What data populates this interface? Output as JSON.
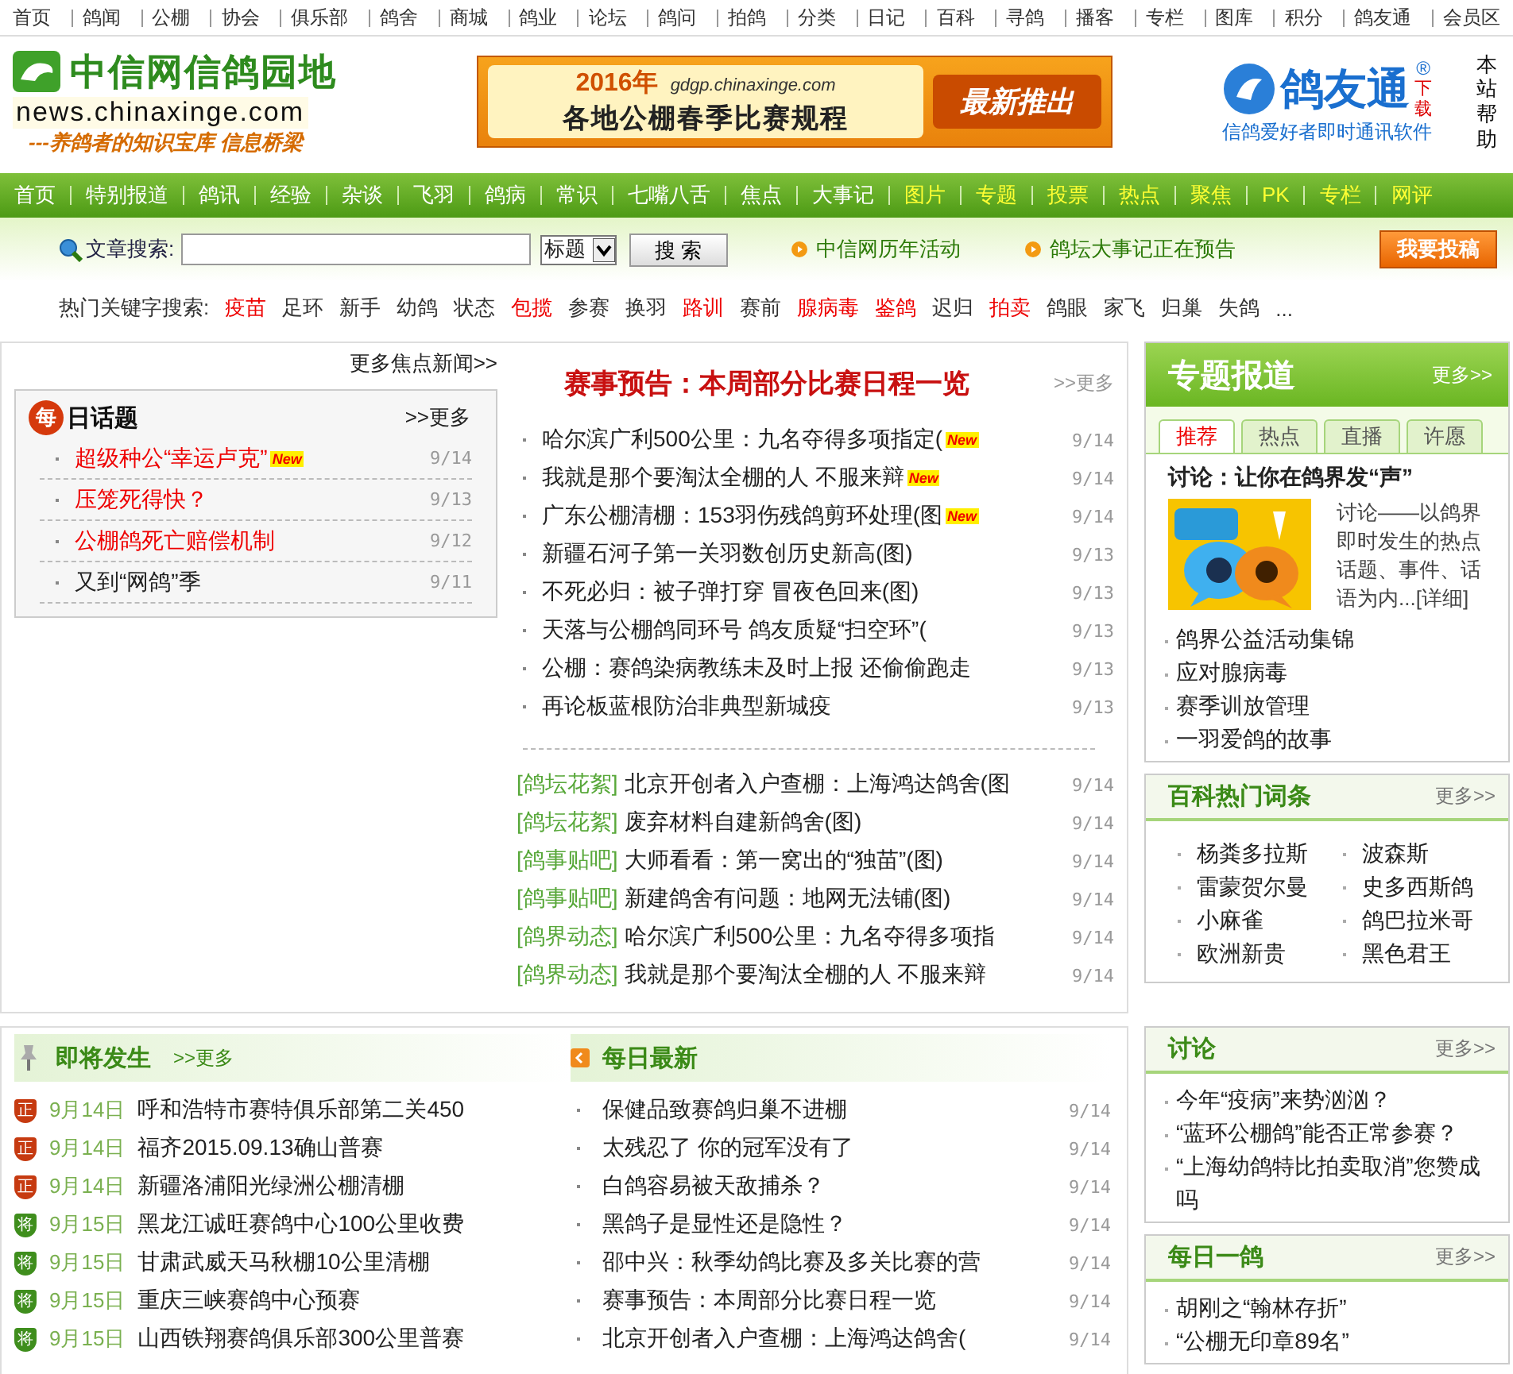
{
  "top_nav": [
    "首页",
    "鸽闻",
    "公棚",
    "协会",
    "俱乐部",
    "鸽舍",
    "商城",
    "鸽业",
    "论坛",
    "鸽问",
    "拍鸽",
    "分类",
    "日记",
    "百科",
    "寻鸽",
    "播客",
    "专栏",
    "图库",
    "积分",
    "鸽友通",
    "会员区"
  ],
  "header": {
    "logo_title": "中信网信鸽园地",
    "logo_url": "news.chinaxinge.com",
    "logo_slogan": "---养鸽者的知识宝库  信息桥梁",
    "banner": {
      "year": "2016年",
      "url": "gdgp.chinaxinge.com",
      "title": "各地公棚春季比赛规程",
      "tag": "最新推出"
    },
    "app": {
      "name": "鸽友通",
      "reg": "®",
      "download": "下载",
      "caption": "信鸽爱好者即时通讯软件"
    },
    "help": "本站帮助"
  },
  "main_nav": [
    {
      "label": "首页",
      "kind": "normal"
    },
    {
      "label": "特别报道",
      "kind": "normal"
    },
    {
      "label": "鸽讯",
      "kind": "normal"
    },
    {
      "label": "经验",
      "kind": "normal"
    },
    {
      "label": "杂谈",
      "kind": "normal"
    },
    {
      "label": "飞羽",
      "kind": "normal"
    },
    {
      "label": "鸽病",
      "kind": "normal"
    },
    {
      "label": "常识",
      "kind": "normal"
    },
    {
      "label": "七嘴八舌",
      "kind": "normal"
    },
    {
      "label": "焦点",
      "kind": "normal"
    },
    {
      "label": "大事记",
      "kind": "normal"
    },
    {
      "label": "图片",
      "kind": "featured"
    },
    {
      "label": "专题",
      "kind": "featured"
    },
    {
      "label": "投票",
      "kind": "featured"
    },
    {
      "label": "热点",
      "kind": "featured"
    },
    {
      "label": "聚焦",
      "kind": "featured"
    },
    {
      "label": "PK",
      "kind": "featured"
    },
    {
      "label": "专栏",
      "kind": "featured"
    },
    {
      "label": "网评",
      "kind": "featured"
    }
  ],
  "search": {
    "label": "文章搜索:",
    "select": "标题",
    "button": "搜 索",
    "links": [
      "中信网历年活动",
      "鸽坛大事记正在预告"
    ],
    "submit": "我要投稿"
  },
  "keywords": {
    "label": "热门关键字搜索:",
    "items": [
      {
        "text": "疫苗",
        "hot": true
      },
      {
        "text": "足环",
        "hot": false
      },
      {
        "text": "新手",
        "hot": false
      },
      {
        "text": "幼鸽",
        "hot": false
      },
      {
        "text": "状态",
        "hot": false
      },
      {
        "text": "包揽",
        "hot": true
      },
      {
        "text": "参赛",
        "hot": false
      },
      {
        "text": "换羽",
        "hot": false
      },
      {
        "text": "路训",
        "hot": true
      },
      {
        "text": "赛前",
        "hot": false
      },
      {
        "text": "腺病毒",
        "hot": true
      },
      {
        "text": "鉴鸽",
        "hot": true
      },
      {
        "text": "迟归",
        "hot": false
      },
      {
        "text": "拍卖",
        "hot": true
      },
      {
        "text": "鸽眼",
        "hot": false
      },
      {
        "text": "家飞",
        "hot": false
      },
      {
        "text": "归巢",
        "hot": false
      },
      {
        "text": "失鸽",
        "hot": false
      }
    ],
    "ellipsis": "..."
  },
  "focus_more": "更多焦点新闻>>",
  "daily_topic": {
    "badge": "每",
    "title": "日话题",
    "more": ">>更多",
    "items": [
      {
        "text": "超级种公“幸运卢克”",
        "hot": true,
        "badge": "New",
        "date": "9/14"
      },
      {
        "text": "压笼死得快？",
        "hot": true,
        "date": "9/13"
      },
      {
        "text": "公棚鸽死亡赔偿机制",
        "hot": true,
        "date": "9/12"
      },
      {
        "text": "又到“网鸽”季",
        "hot": false,
        "date": "9/11"
      }
    ]
  },
  "headline": {
    "title": "赛事预告：本周部分比赛日程一览",
    "more": ">>更多",
    "items": [
      {
        "text": "哈尔滨广利500公里：九名夺得多项指定(",
        "badge": "New",
        "date": "9/14"
      },
      {
        "text": "我就是那个要淘汰全棚的人 不服来辩",
        "badge": "New",
        "date": "9/14"
      },
      {
        "text": "广东公棚清棚：153羽伤残鸽剪环处理(图",
        "badge": "New",
        "date": "9/14"
      },
      {
        "text": "新疆石河子第一关羽数创历史新高(图)",
        "date": "9/13"
      },
      {
        "text": "不死必归：被子弹打穿 冒夜色回来(图)",
        "date": "9/13"
      },
      {
        "text": "天落与公棚鸽同环号 鸽友质疑“扫空环”(",
        "date": "9/13"
      },
      {
        "text": "公棚：赛鸽染病教练未及时上报 还偷偷跑走",
        "date": "9/13"
      },
      {
        "text": "再论板蓝根防治非典型新城疫",
        "date": "9/13"
      }
    ],
    "tagged": [
      {
        "tag": "[鸽坛花絮]",
        "text": "北京开创者入户查棚：上海鸿达鸽舍(图",
        "date": "9/14"
      },
      {
        "tag": "[鸽坛花絮]",
        "text": "废弃材料自建新鸽舍(图)",
        "date": "9/14"
      },
      {
        "tag": "[鸽事贴吧]",
        "text": "大师看看：第一窝出的“独苗”(图)",
        "date": "9/14"
      },
      {
        "tag": "[鸽事贴吧]",
        "text": "新建鸽舍有问题：地网无法铺(图)",
        "date": "9/14"
      },
      {
        "tag": "[鸽界动态]",
        "text": "哈尔滨广利500公里：九名夺得多项指",
        "date": "9/14"
      },
      {
        "tag": "[鸽界动态]",
        "text": "我就是那个要淘汰全棚的人 不服来辩",
        "date": "9/14"
      }
    ]
  },
  "special": {
    "title": "专题报道",
    "more": "更多>>",
    "tabs": [
      {
        "label": "推荐",
        "selected": true
      },
      {
        "label": "热点",
        "selected": false
      },
      {
        "label": "直播",
        "selected": false
      },
      {
        "label": "许愿",
        "selected": false
      }
    ],
    "feature_title": "讨论：让你在鸽界发“声”",
    "feature_text": "讨论——以鸽界即时发生的热点话题、事件、话语为内...",
    "feature_link": "[详细]",
    "items": [
      "鸽界公益活动集锦",
      "应对腺病毒",
      "赛季训放管理",
      "一羽爱鸽的故事"
    ]
  },
  "wiki": {
    "title": "百科热门词条",
    "more": "更多>>",
    "items": [
      "杨粪多拉斯",
      "波森斯",
      "雷蒙贺尔曼",
      "史多西斯鸽",
      "小麻雀",
      "鸽巴拉米哥",
      "欧洲新贵",
      "黑色君王"
    ]
  },
  "upcoming": {
    "title": "即将发生",
    "more": ">>更多",
    "items": [
      {
        "kind": "ongoing",
        "badge": "正",
        "date": "9月14日",
        "text": "呼和浩特市赛特俱乐部第二关450"
      },
      {
        "kind": "ongoing",
        "badge": "正",
        "date": "9月14日",
        "text": "福齐2015.09.13确山普赛"
      },
      {
        "kind": "ongoing",
        "badge": "正",
        "date": "9月14日",
        "text": "新疆洛浦阳光绿洲公棚清棚"
      },
      {
        "kind": "coming",
        "badge": "将",
        "date": "9月15日",
        "text": "黑龙江诚旺赛鸽中心100公里收费"
      },
      {
        "kind": "coming",
        "badge": "将",
        "date": "9月15日",
        "text": "甘肃武威天马秋棚10公里清棚"
      },
      {
        "kind": "coming",
        "badge": "将",
        "date": "9月15日",
        "text": "重庆三峡赛鸽中心预赛"
      },
      {
        "kind": "coming",
        "badge": "将",
        "date": "9月15日",
        "text": "山西铁翔赛鸽俱乐部300公里普赛"
      }
    ]
  },
  "daily_latest": {
    "title": "每日最新",
    "items": [
      {
        "text": "保健品致赛鸽归巢不进棚",
        "date": "9/14"
      },
      {
        "text": "太残忍了 你的冠军没有了",
        "date": "9/14"
      },
      {
        "text": "白鸽容易被天敌捕杀？",
        "date": "9/14"
      },
      {
        "text": "黑鸽子是显性还是隐性？",
        "date": "9/14"
      },
      {
        "text": "邵中兴：秋季幼鸽比赛及多关比赛的营",
        "date": "9/14"
      },
      {
        "text": "赛事预告：本周部分比赛日程一览",
        "date": "9/14"
      },
      {
        "text": "北京开创者入户查棚：上海鸿达鸽舍(",
        "date": "9/14"
      }
    ]
  },
  "discussion": {
    "title": "讨论",
    "more": "更多>>",
    "items": [
      "今年“疫病”来势汹汹？",
      "“蓝环公棚鸽”能否正常参赛？",
      "“上海幼鸽特比拍卖取消”您赞成吗"
    ]
  },
  "pigeon_of_day": {
    "title": "每日一鸽",
    "more": "更多>>",
    "items": [
      "胡刚之“翰林存折”",
      "“公棚无印章89名”"
    ]
  }
}
